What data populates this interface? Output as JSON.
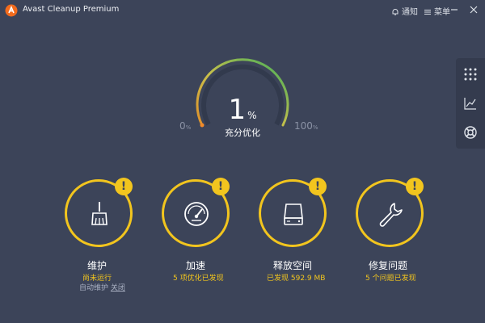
{
  "window": {
    "title": "Avast Cleanup Premium",
    "notify_label": "通知",
    "menu_label": "菜单",
    "icons": [
      "avast-logo-icon",
      "bell-icon",
      "menu-icon",
      "minimize-icon",
      "close-icon"
    ]
  },
  "gauge": {
    "value": "1",
    "unit": "%",
    "label": "充分优化",
    "min_label": "0",
    "max_label": "100",
    "tick_unit": "%",
    "progress": 0.01
  },
  "side_panel": {
    "icons": [
      "grid-icon",
      "chart-icon",
      "help-lifebuoy-icon"
    ]
  },
  "cards": [
    {
      "title": "维护",
      "status": "尚未运行",
      "sub_prefix": "自动维护",
      "sub_link": "关闭",
      "icon": "broom-icon",
      "badge": "!"
    },
    {
      "title": "加速",
      "status": "5 项优化已发现",
      "icon": "speedometer-icon",
      "badge": "!"
    },
    {
      "title": "释放空间",
      "status": "已发现 592.9 MB",
      "icon": "hard-drive-icon",
      "badge": "!"
    },
    {
      "title": "修复问题",
      "status": "5 个问题已发现",
      "icon": "wrench-icon",
      "badge": "!"
    }
  ],
  "colors": {
    "background": "#3c4459",
    "accent": "#f2c51e",
    "panel": "#343b4e"
  }
}
